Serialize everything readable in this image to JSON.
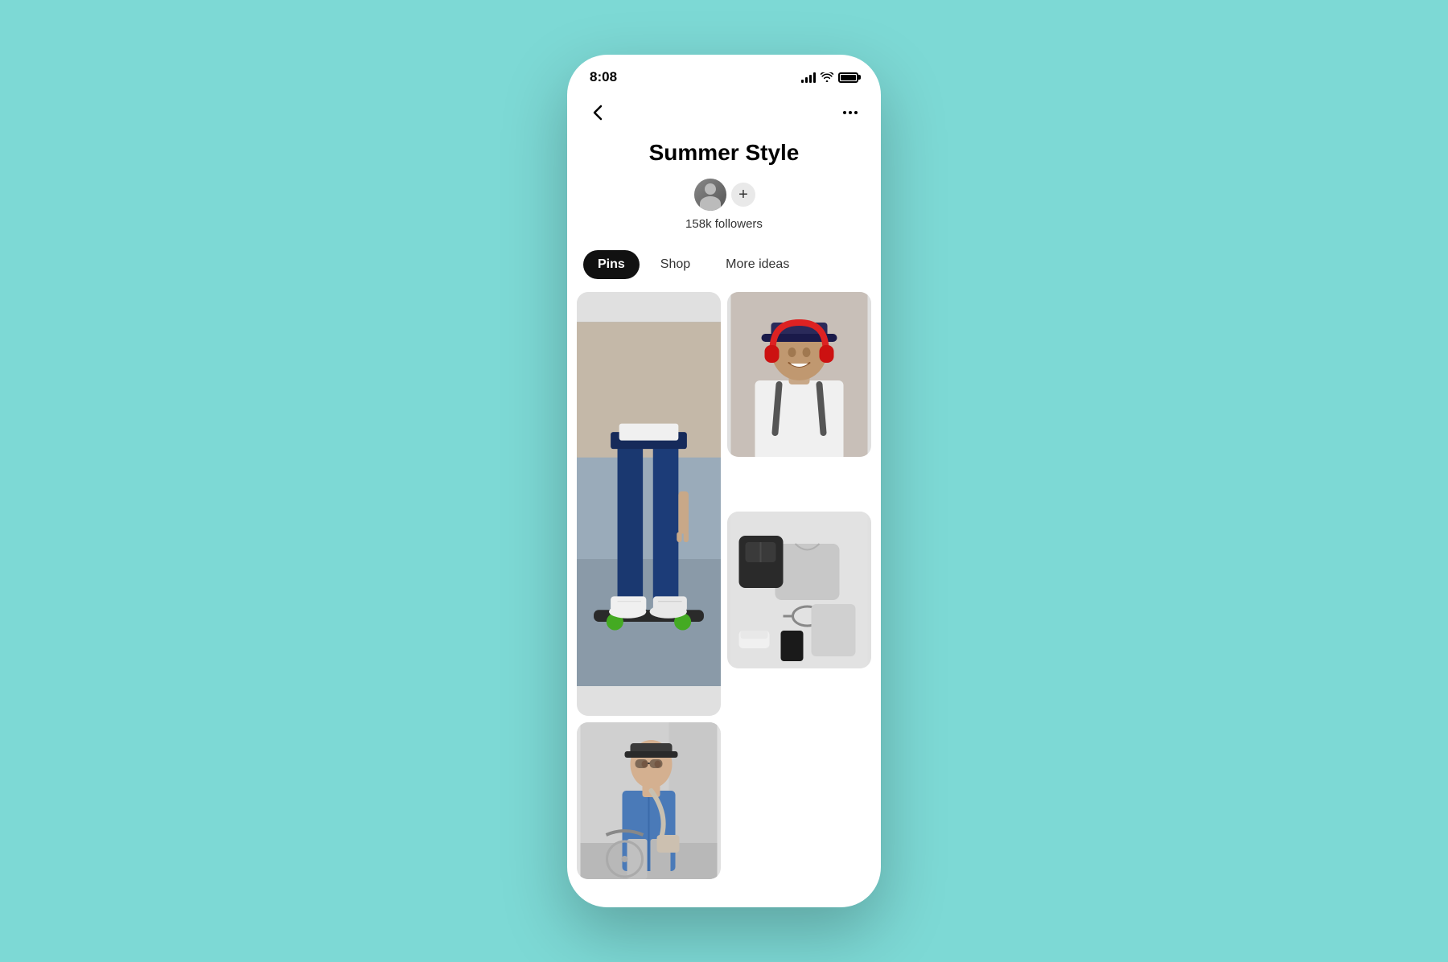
{
  "status_bar": {
    "time": "8:08",
    "signal_label": "signal",
    "wifi_label": "wifi",
    "battery_label": "battery"
  },
  "nav": {
    "back_label": "back",
    "more_label": "more options"
  },
  "board": {
    "title": "Summer Style",
    "followers_count": "158k followers"
  },
  "tabs": [
    {
      "label": "Pins",
      "active": true
    },
    {
      "label": "Shop",
      "active": false
    },
    {
      "label": "More ideas",
      "active": false
    }
  ],
  "pins": [
    {
      "id": "skate",
      "alt": "Skateboarder jeans and white sneakers",
      "position": "tall-left"
    },
    {
      "id": "headphones",
      "alt": "Man with red headphones smiling",
      "position": "top-right"
    },
    {
      "id": "flatlay",
      "alt": "Flat lay of backpack sunglasses sneakers shirt",
      "position": "bottom-left"
    },
    {
      "id": "street",
      "alt": "Man in denim shirt with bicycle",
      "position": "bottom-right"
    }
  ],
  "colors": {
    "background": "#7dd9d5",
    "phone_bg": "#ffffff",
    "tab_active_bg": "#111111",
    "tab_active_text": "#ffffff",
    "tab_inactive_text": "#333333"
  }
}
